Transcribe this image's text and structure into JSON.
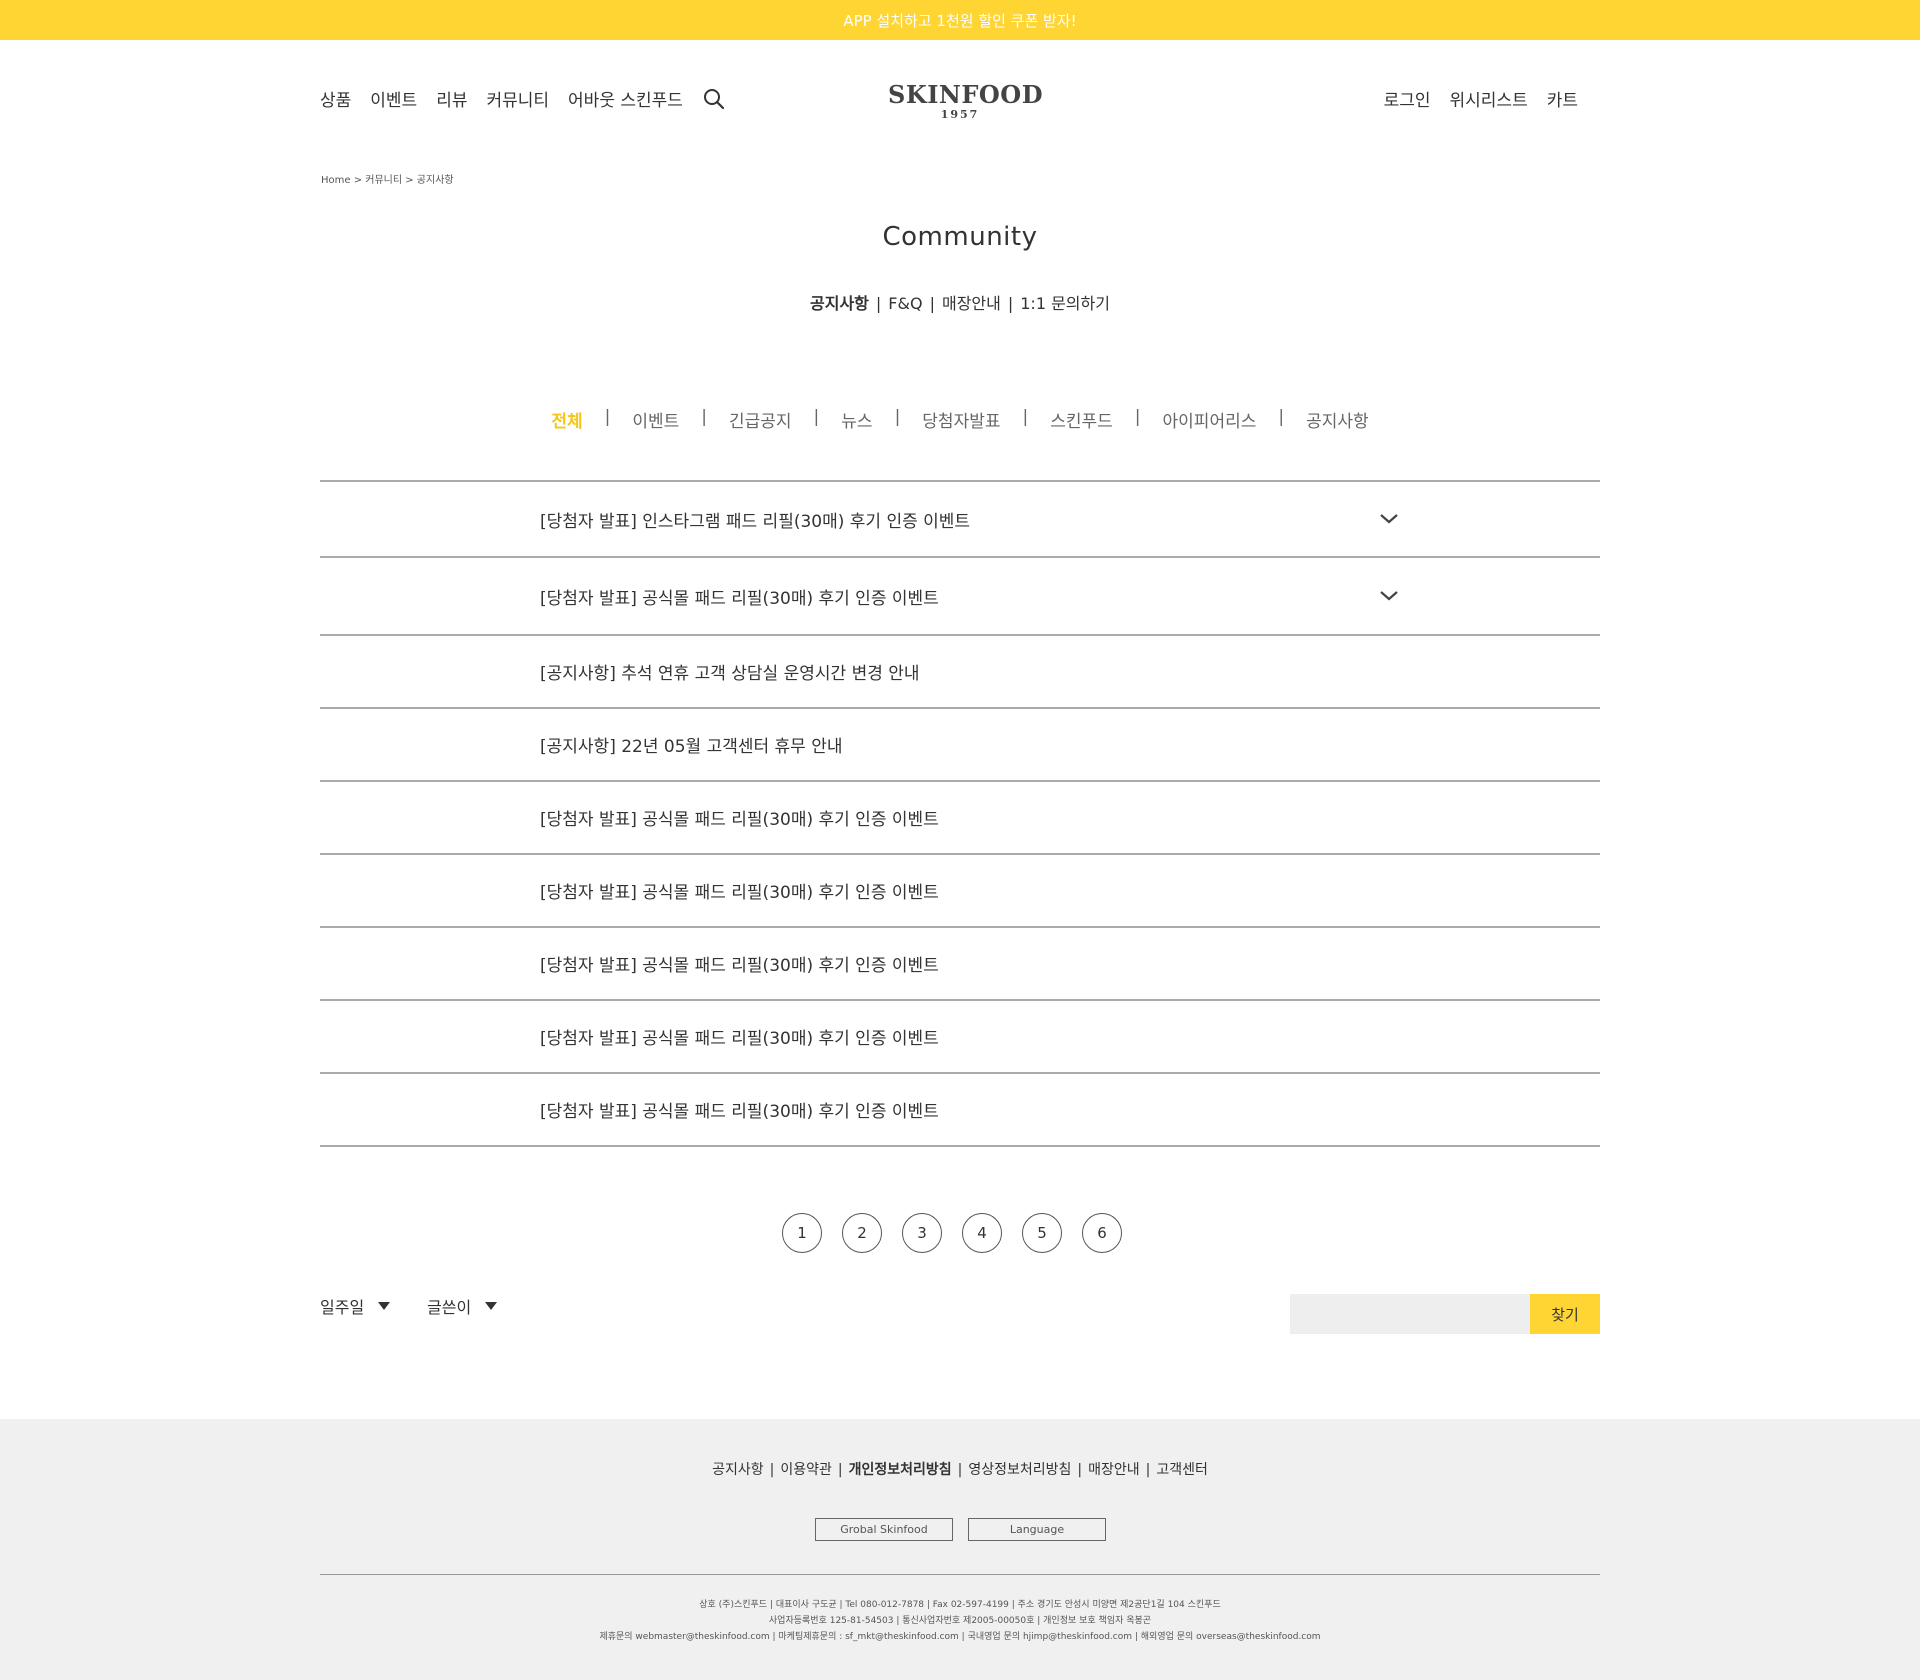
{
  "topbar": {
    "text": "APP 설치하고 1천원 할인 쿠폰 받자!"
  },
  "nav": {
    "left": [
      "상품",
      "이벤트",
      "리뷰",
      "커뮤니티",
      "어바웃 스킨푸드"
    ],
    "right": [
      "로그인",
      "위시리스트",
      "카트"
    ],
    "search_icon": "search-icon"
  },
  "logo": {
    "main": "SKINFOOD",
    "sub": "1957"
  },
  "breadcrumb": "Home > 커뮤니티 > 공지사항",
  "page_title": "Community",
  "subnav": [
    "공지사항",
    "F&Q",
    "매장안내",
    "1:1 문의하기"
  ],
  "categories": [
    "전체",
    "이벤트",
    "긴급공지",
    "뉴스",
    "당첨자발표",
    "스킨푸드",
    "아이피어리스",
    "공지사항"
  ],
  "posts": [
    {
      "title": "[당첨자 발표] 인스타그램 패드 리필(30매) 후기 인증 이벤트",
      "expandable": true
    },
    {
      "title": "[당첨자 발표] 공식몰 패드 리필(30매) 후기 인증 이벤트",
      "expandable": true
    },
    {
      "title": "[공지사항] 추석 연휴 고객 상담실 운영시간 변경 안내",
      "expandable": false
    },
    {
      "title": "[공지사항] 22년 05월 고객센터 휴무 안내",
      "expandable": false
    },
    {
      "title": "[당첨자 발표] 공식몰 패드 리필(30매) 후기 인증 이벤트",
      "expandable": false
    },
    {
      "title": "[당첨자 발표] 공식몰 패드 리필(30매) 후기 인증 이벤트",
      "expandable": false
    },
    {
      "title": "[당첨자 발표] 공식몰 패드 리필(30매) 후기 인증 이벤트",
      "expandable": false
    },
    {
      "title": "[당첨자 발표] 공식몰 패드 리필(30매) 후기 인증 이벤트",
      "expandable": false
    },
    {
      "title": "[당첨자 발표] 공식몰 패드 리필(30매) 후기 인증 이벤트",
      "expandable": false
    }
  ],
  "pagination": [
    "1",
    "2",
    "3",
    "4",
    "5",
    "6"
  ],
  "filters": {
    "period": "일주일",
    "field": "글쓴이"
  },
  "search": {
    "placeholder": "",
    "button": "찾기"
  },
  "footer": {
    "links": [
      "공지사항",
      "이용약관",
      "개인정보처리방침",
      "영상정보처리방침",
      "매장안내",
      "고객센터"
    ],
    "buttons": [
      "Grobal Skinfood",
      "Language"
    ],
    "info": [
      "상호 (주)스킨푸드 | 대표이사 구도균 | Tel 080-012-7878  | Fax 02-597-4199 | 주소 경기도 안성시 미양면 제2공단1길 104 스킨푸드",
      "사업자등록번호 125-81-54503 | 통신사업자번호 제2005-00050호 | 개인정보 보호 책임자 옥봉곤",
      "제휴문의 webmaster@theskinfood.com | 마케팅제휴문의 : sf_mkt@theskinfood.com | 국내영업 문의 hjimp@theskinfood.com | 해외영업 문의 overseas@theskinfood.com"
    ]
  },
  "colors": {
    "accent": "#ffd534",
    "active_category": "#f5c518",
    "footer_bg": "#f0f0f0"
  }
}
